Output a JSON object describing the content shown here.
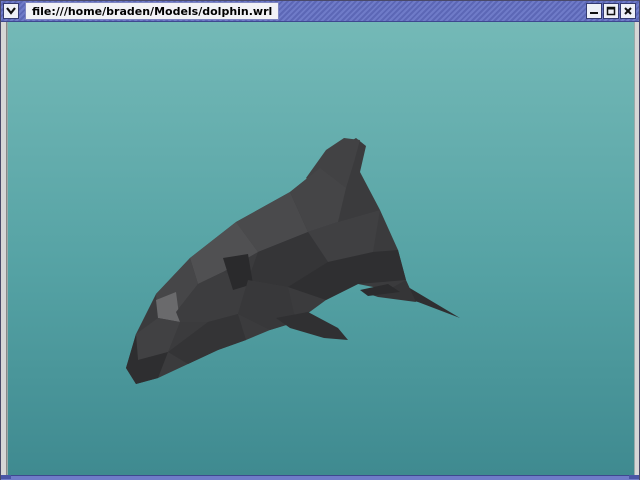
{
  "window": {
    "title": "file:///home/braden/Models/dolphin.wrl",
    "menu_icon": "chevron-down-icon",
    "controls": {
      "minimize_icon": "minimize-icon",
      "maximize_icon": "maximize-icon",
      "close_icon": "close-icon"
    }
  },
  "scene": {
    "model": "dolphin-3d-model",
    "background_top": "#74b9b7",
    "background_bottom": "#3f8a90",
    "model_color": "#3a3a3c"
  }
}
